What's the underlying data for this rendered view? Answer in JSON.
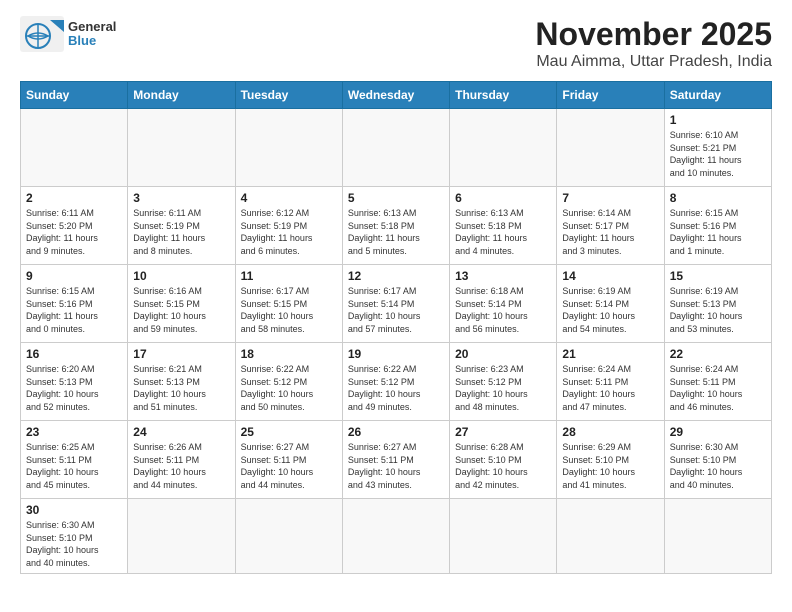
{
  "header": {
    "logo_general": "General",
    "logo_blue": "Blue",
    "month": "November 2025",
    "location": "Mau Aimma, Uttar Pradesh, India"
  },
  "days_of_week": [
    "Sunday",
    "Monday",
    "Tuesday",
    "Wednesday",
    "Thursday",
    "Friday",
    "Saturday"
  ],
  "weeks": [
    [
      {
        "day": "",
        "info": ""
      },
      {
        "day": "",
        "info": ""
      },
      {
        "day": "",
        "info": ""
      },
      {
        "day": "",
        "info": ""
      },
      {
        "day": "",
        "info": ""
      },
      {
        "day": "",
        "info": ""
      },
      {
        "day": "1",
        "info": "Sunrise: 6:10 AM\nSunset: 5:21 PM\nDaylight: 11 hours\nand 10 minutes."
      }
    ],
    [
      {
        "day": "2",
        "info": "Sunrise: 6:11 AM\nSunset: 5:20 PM\nDaylight: 11 hours\nand 9 minutes."
      },
      {
        "day": "3",
        "info": "Sunrise: 6:11 AM\nSunset: 5:19 PM\nDaylight: 11 hours\nand 8 minutes."
      },
      {
        "day": "4",
        "info": "Sunrise: 6:12 AM\nSunset: 5:19 PM\nDaylight: 11 hours\nand 6 minutes."
      },
      {
        "day": "5",
        "info": "Sunrise: 6:13 AM\nSunset: 5:18 PM\nDaylight: 11 hours\nand 5 minutes."
      },
      {
        "day": "6",
        "info": "Sunrise: 6:13 AM\nSunset: 5:18 PM\nDaylight: 11 hours\nand 4 minutes."
      },
      {
        "day": "7",
        "info": "Sunrise: 6:14 AM\nSunset: 5:17 PM\nDaylight: 11 hours\nand 3 minutes."
      },
      {
        "day": "8",
        "info": "Sunrise: 6:15 AM\nSunset: 5:16 PM\nDaylight: 11 hours\nand 1 minute."
      }
    ],
    [
      {
        "day": "9",
        "info": "Sunrise: 6:15 AM\nSunset: 5:16 PM\nDaylight: 11 hours\nand 0 minutes."
      },
      {
        "day": "10",
        "info": "Sunrise: 6:16 AM\nSunset: 5:15 PM\nDaylight: 10 hours\nand 59 minutes."
      },
      {
        "day": "11",
        "info": "Sunrise: 6:17 AM\nSunset: 5:15 PM\nDaylight: 10 hours\nand 58 minutes."
      },
      {
        "day": "12",
        "info": "Sunrise: 6:17 AM\nSunset: 5:14 PM\nDaylight: 10 hours\nand 57 minutes."
      },
      {
        "day": "13",
        "info": "Sunrise: 6:18 AM\nSunset: 5:14 PM\nDaylight: 10 hours\nand 56 minutes."
      },
      {
        "day": "14",
        "info": "Sunrise: 6:19 AM\nSunset: 5:14 PM\nDaylight: 10 hours\nand 54 minutes."
      },
      {
        "day": "15",
        "info": "Sunrise: 6:19 AM\nSunset: 5:13 PM\nDaylight: 10 hours\nand 53 minutes."
      }
    ],
    [
      {
        "day": "16",
        "info": "Sunrise: 6:20 AM\nSunset: 5:13 PM\nDaylight: 10 hours\nand 52 minutes."
      },
      {
        "day": "17",
        "info": "Sunrise: 6:21 AM\nSunset: 5:13 PM\nDaylight: 10 hours\nand 51 minutes."
      },
      {
        "day": "18",
        "info": "Sunrise: 6:22 AM\nSunset: 5:12 PM\nDaylight: 10 hours\nand 50 minutes."
      },
      {
        "day": "19",
        "info": "Sunrise: 6:22 AM\nSunset: 5:12 PM\nDaylight: 10 hours\nand 49 minutes."
      },
      {
        "day": "20",
        "info": "Sunrise: 6:23 AM\nSunset: 5:12 PM\nDaylight: 10 hours\nand 48 minutes."
      },
      {
        "day": "21",
        "info": "Sunrise: 6:24 AM\nSunset: 5:11 PM\nDaylight: 10 hours\nand 47 minutes."
      },
      {
        "day": "22",
        "info": "Sunrise: 6:24 AM\nSunset: 5:11 PM\nDaylight: 10 hours\nand 46 minutes."
      }
    ],
    [
      {
        "day": "23",
        "info": "Sunrise: 6:25 AM\nSunset: 5:11 PM\nDaylight: 10 hours\nand 45 minutes."
      },
      {
        "day": "24",
        "info": "Sunrise: 6:26 AM\nSunset: 5:11 PM\nDaylight: 10 hours\nand 44 minutes."
      },
      {
        "day": "25",
        "info": "Sunrise: 6:27 AM\nSunset: 5:11 PM\nDaylight: 10 hours\nand 44 minutes."
      },
      {
        "day": "26",
        "info": "Sunrise: 6:27 AM\nSunset: 5:11 PM\nDaylight: 10 hours\nand 43 minutes."
      },
      {
        "day": "27",
        "info": "Sunrise: 6:28 AM\nSunset: 5:10 PM\nDaylight: 10 hours\nand 42 minutes."
      },
      {
        "day": "28",
        "info": "Sunrise: 6:29 AM\nSunset: 5:10 PM\nDaylight: 10 hours\nand 41 minutes."
      },
      {
        "day": "29",
        "info": "Sunrise: 6:30 AM\nSunset: 5:10 PM\nDaylight: 10 hours\nand 40 minutes."
      }
    ],
    [
      {
        "day": "30",
        "info": "Sunrise: 6:30 AM\nSunset: 5:10 PM\nDaylight: 10 hours\nand 40 minutes."
      },
      {
        "day": "",
        "info": ""
      },
      {
        "day": "",
        "info": ""
      },
      {
        "day": "",
        "info": ""
      },
      {
        "day": "",
        "info": ""
      },
      {
        "day": "",
        "info": ""
      },
      {
        "day": "",
        "info": ""
      }
    ]
  ]
}
